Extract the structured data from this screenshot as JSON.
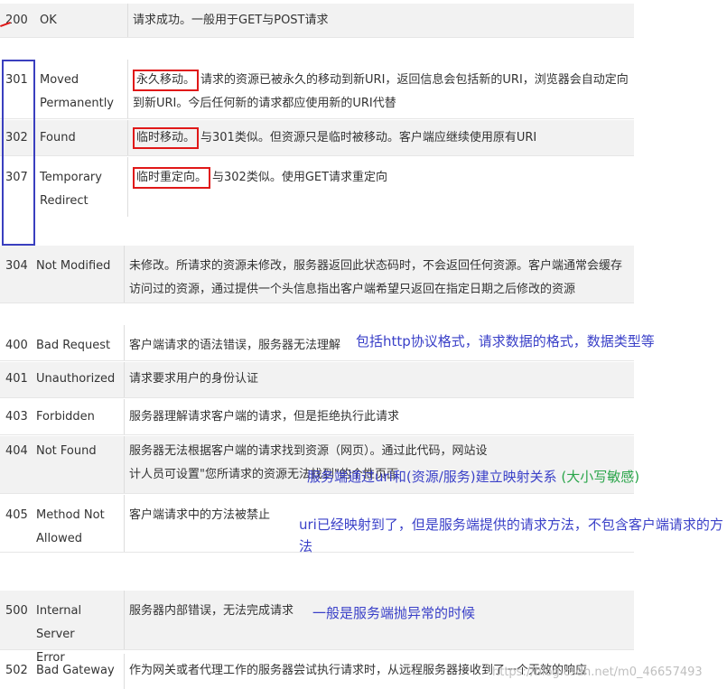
{
  "rows": [
    {
      "code": "200",
      "name": [
        "OK"
      ],
      "desc": "请求成功。一般用于GET与POST请求"
    },
    {
      "code": "301",
      "name": [
        "Moved",
        "Permanently"
      ],
      "highlight": "永久移动。",
      "desc": "请求的资源已被永久的移动到新URI，返回信息会包括新的URI，浏览器会自动定向到新URI。今后任何新的请求都应使用新的URI代替"
    },
    {
      "code": "302",
      "name": [
        "Found"
      ],
      "highlight": "临时移动。",
      "desc": "与301类似。但资源只是临时被移动。客户端应继续使用原有URI"
    },
    {
      "code": "307",
      "name": [
        "Temporary",
        "Redirect"
      ],
      "highlight": "临时重定向。",
      "desc": "与302类似。使用GET请求重定向"
    },
    {
      "code": "304",
      "name": [
        "Not Modified"
      ],
      "desc": "未修改。所请求的资源未修改，服务器返回此状态码时，不会返回任何资源。客户端通常会缓存访问过的资源，通过提供一个头信息指出客户端希望只返回在指定日期之后修改的资源"
    },
    {
      "code": "400",
      "name": [
        "Bad Request"
      ],
      "desc": "客户端请求的语法错误，服务器无法理解"
    },
    {
      "code": "401",
      "name": [
        "Unauthorized"
      ],
      "desc": "请求要求用户的身份认证"
    },
    {
      "code": "403",
      "name": [
        "Forbidden"
      ],
      "desc": "服务器理解请求客户端的请求，但是拒绝执行此请求"
    },
    {
      "code": "404",
      "name": [
        "Not Found"
      ],
      "desc": "服务器无法根据客户端的请求找到资源（网页）。通过此代码，网站设计人员可设置\"您所请求的资源无法找到\"的个性页面"
    },
    {
      "code": "405",
      "name": [
        "Method Not",
        "Allowed"
      ],
      "desc": "客户端请求中的方法被禁止"
    },
    {
      "code": "500",
      "name": [
        "Internal Server",
        "Error"
      ],
      "desc": "服务器内部错误，无法完成请求"
    },
    {
      "code": "502",
      "name": [
        "Bad Gateway"
      ],
      "desc": "作为网关或者代理工作的服务器尝试执行请求时，从远程服务器接收到了一个无效的响应"
    }
  ],
  "notes": {
    "n400": "包括http协议格式，请求数据的格式，数据类型等",
    "n404": "服务端通过uri和(资源/服务)建立映射关系",
    "n404_green": "(大小写敏感)",
    "n405": "uri已经映射到了，但是服务端提供的请求方法，不包含客户端请求的方法",
    "n500": "一般是服务端抛异常的时候"
  },
  "watermark": "https://blog.csdn.net/m0_46657493",
  "colors": {
    "annotation_blue": "#3a40c8",
    "annotation_green": "#2aa54a",
    "highlight_red": "#e01818",
    "row_shade": "#f2f2f2"
  }
}
